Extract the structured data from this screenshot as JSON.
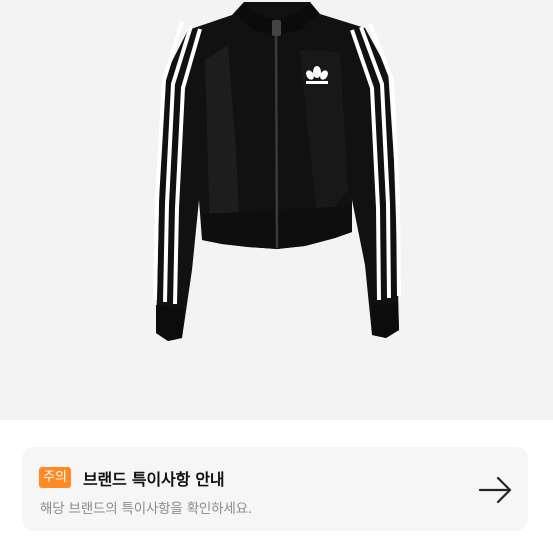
{
  "product": {
    "image_icon": "track-jacket-product-image",
    "logo_icon": "trefoil-logo"
  },
  "notice": {
    "badge": "주의",
    "title": "브랜드 특이사항 안내",
    "description": "해당 브랜드의 특이사항을 확인하세요.",
    "arrow_icon": "arrow-right-icon",
    "accent": "#ff8a23"
  }
}
